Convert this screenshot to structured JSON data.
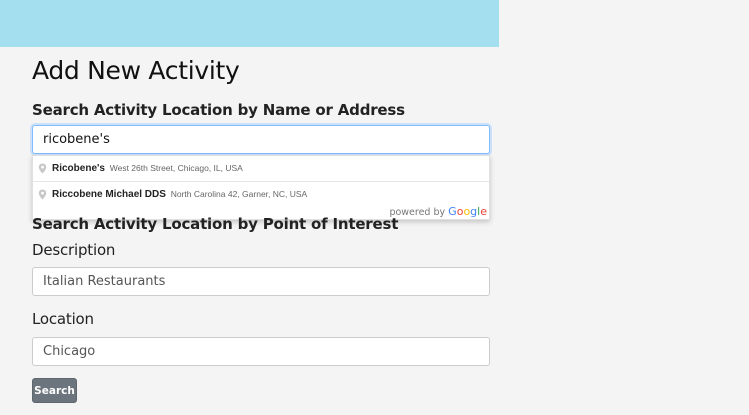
{
  "page": {
    "title": "Add New Activity"
  },
  "search_by_name": {
    "label": "Search Activity Location by Name or Address",
    "value": "ricobene's",
    "suggestions": [
      {
        "main": "Ricobene's",
        "secondary": "West 26th Street, Chicago, IL, USA"
      },
      {
        "main": "Riccobene Michael DDS",
        "secondary": "North Carolina 42, Garner, NC, USA"
      }
    ],
    "powered_by": "powered by",
    "google": [
      "G",
      "o",
      "o",
      "g",
      "l",
      "e"
    ],
    "google_colors": [
      "#4285F4",
      "#EA4335",
      "#FBBC05",
      "#4285F4",
      "#34A853",
      "#EA4335"
    ]
  },
  "search_by_poi": {
    "label": "Search Activity Location by Point of Interest",
    "description_label": "Description",
    "description_value": "Italian Restaurants",
    "location_label": "Location",
    "location_value": "Chicago",
    "search_button": "Search"
  },
  "colors": {
    "header": "#a3dfee",
    "button": "#6c757d"
  }
}
